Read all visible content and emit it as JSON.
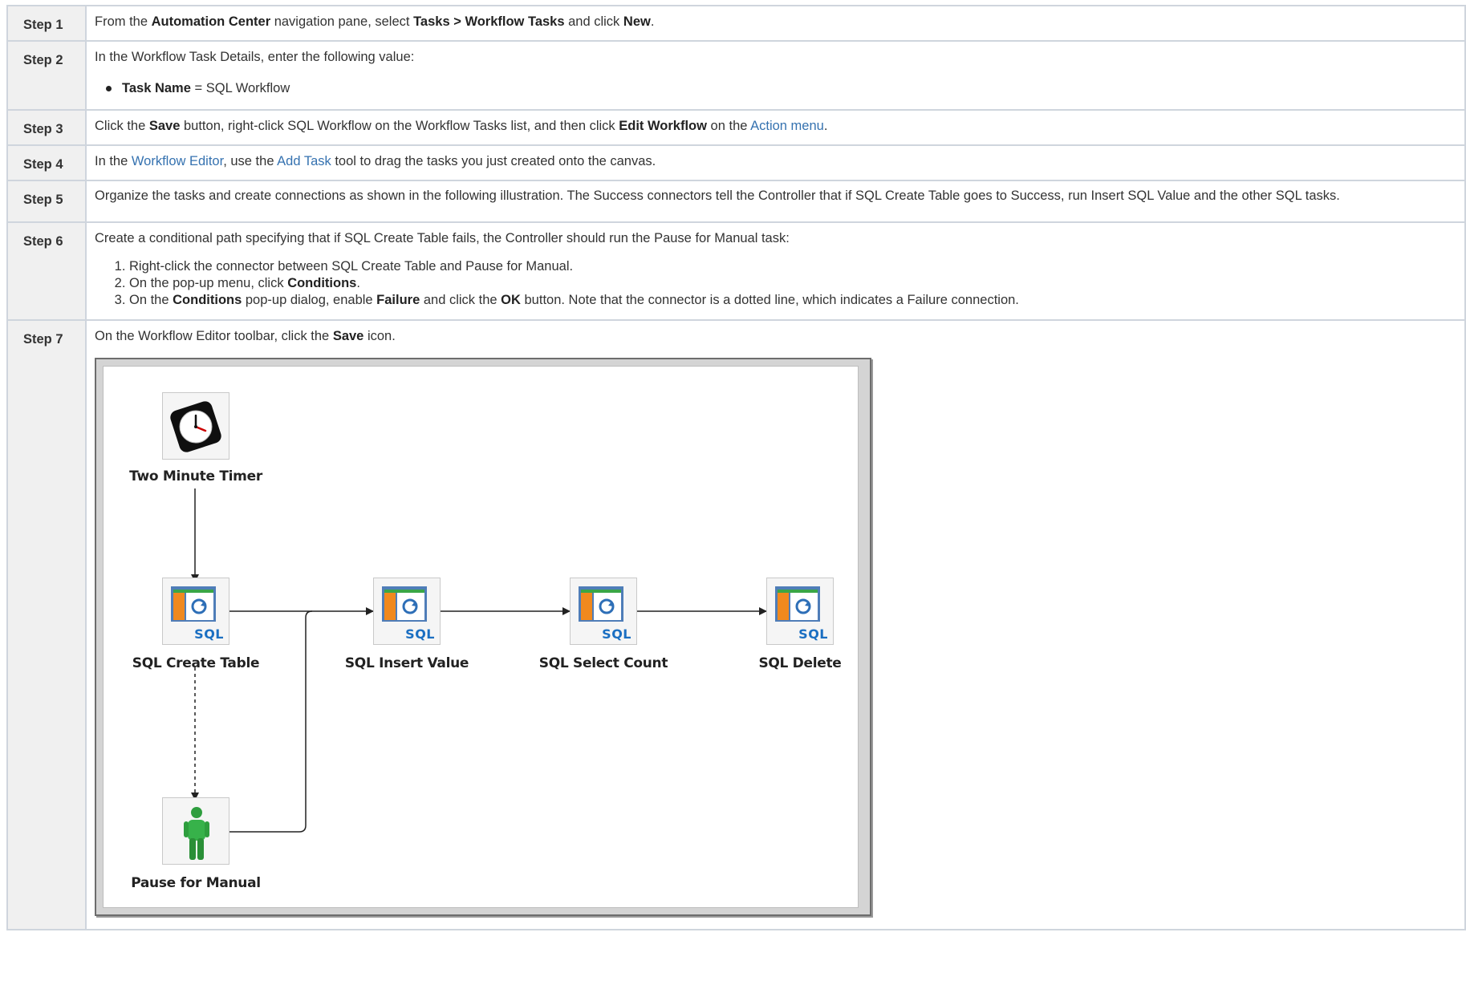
{
  "steps": [
    {
      "label": "Step 1",
      "parts": [
        "From the ",
        "Automation Center",
        " navigation pane, select ",
        "Tasks > Workflow Tasks",
        " and click ",
        "New",
        "."
      ]
    },
    {
      "label": "Step 2",
      "intro": "In the Workflow Task Details, enter the following value:",
      "item_key": "Task Name",
      "item_value": " = SQL Workflow"
    },
    {
      "label": "Step 3",
      "parts": [
        "Click the ",
        "Save",
        " button, right-click SQL Workflow on the Workflow Tasks list, and then click ",
        "Edit Workflow",
        " on the ",
        "Action menu",
        "."
      ]
    },
    {
      "label": "Step 4",
      "parts": [
        "In the ",
        "Workflow Editor",
        ", use the ",
        "Add Task",
        " tool to drag the tasks you just created onto the canvas."
      ]
    },
    {
      "label": "Step 5",
      "text": "Organize the tasks and create connections as shown in the following illustration. The Success connectors tell the Controller that if SQL Create Table goes to Success, run Insert SQL Value and the other SQL tasks."
    },
    {
      "label": "Step 6",
      "intro": "Create a conditional path specifying that if SQL Create Table fails, the Controller should run the Pause for Manual task:",
      "sub1": "Right-click the connector between SQL Create Table and Pause for Manual.",
      "sub2_parts": [
        "On the pop-up menu, click ",
        "Conditions",
        "."
      ],
      "sub3_parts": [
        "On the ",
        "Conditions",
        " pop-up dialog, enable ",
        "Failure",
        " and click the ",
        "OK",
        " button. Note that the connector is a dotted line, which indicates a Failure connection."
      ]
    },
    {
      "label": "Step 7",
      "parts": [
        "On the Workflow Editor toolbar, click the ",
        "Save",
        " icon."
      ]
    }
  ],
  "diagram": {
    "sql_badge": "SQL",
    "nodes": {
      "timer": "Two Minute Timer",
      "create": "SQL Create Table",
      "insert": "SQL Insert Value",
      "select": "SQL Select Count",
      "delete": "SQL Delete",
      "pause": "Pause for Manual"
    }
  }
}
